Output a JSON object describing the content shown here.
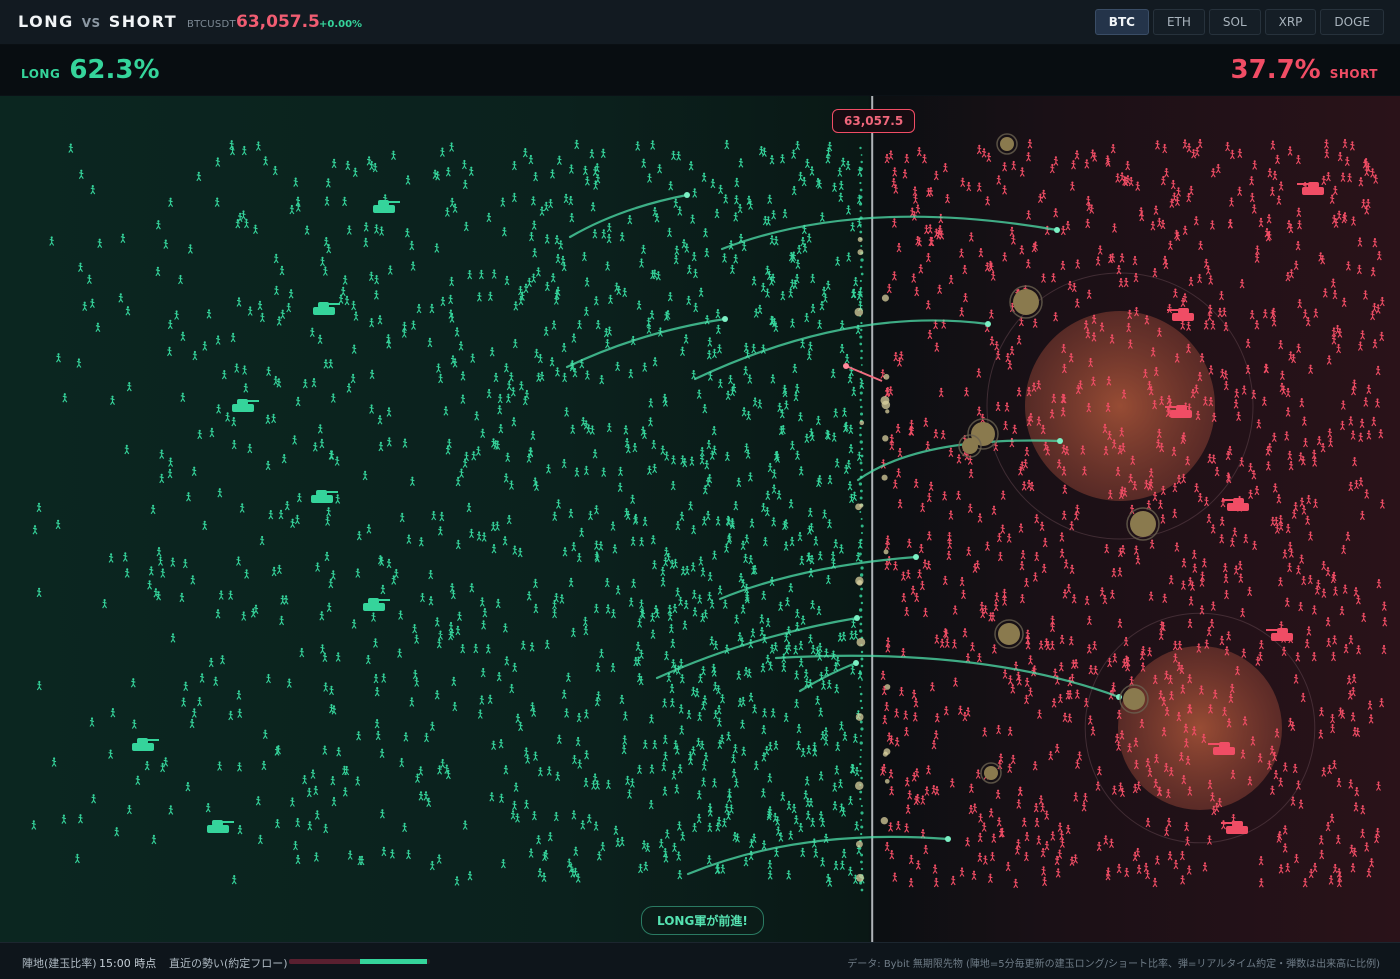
{
  "header": {
    "brand_long": "LONG",
    "brand_vs": "VS",
    "brand_short": "SHORT",
    "ticker": "BTCUSDT",
    "price": "63,057.5",
    "change": "+0.00%",
    "symbols": [
      "BTC",
      "ETH",
      "SOL",
      "XRP",
      "DOGE"
    ],
    "active_symbol": "BTC"
  },
  "ratio": {
    "long_label": "LONG",
    "long_pct": "62.3%",
    "long_value": 62.3,
    "short_label": "SHORT",
    "short_pct": "37.7%",
    "short_value": 37.7
  },
  "battlefield": {
    "price_marker": "63,057.5",
    "advance_message": "LONG軍が前進!"
  },
  "footer": {
    "camp_label": "陣地(建玉比率)",
    "time_label": "15:00 時点",
    "flow_label": "直近の勢い(約定フロー)",
    "flow_long_fraction": 0.5,
    "source_note": "データ: Bybit 無期限先物 (陣地=5分毎更新の建玉ロング/ショート比率、弾=リアルタイム約定・弾数は出来高に比例)"
  },
  "colors": {
    "long": "#35d49b",
    "short": "#f04d65",
    "background": "#0b1116"
  },
  "icons": {
    "long_unit": "soldier-icon",
    "short_unit": "soldier-icon",
    "long_vehicle": "tank-icon",
    "short_vehicle": "tank-icon"
  }
}
